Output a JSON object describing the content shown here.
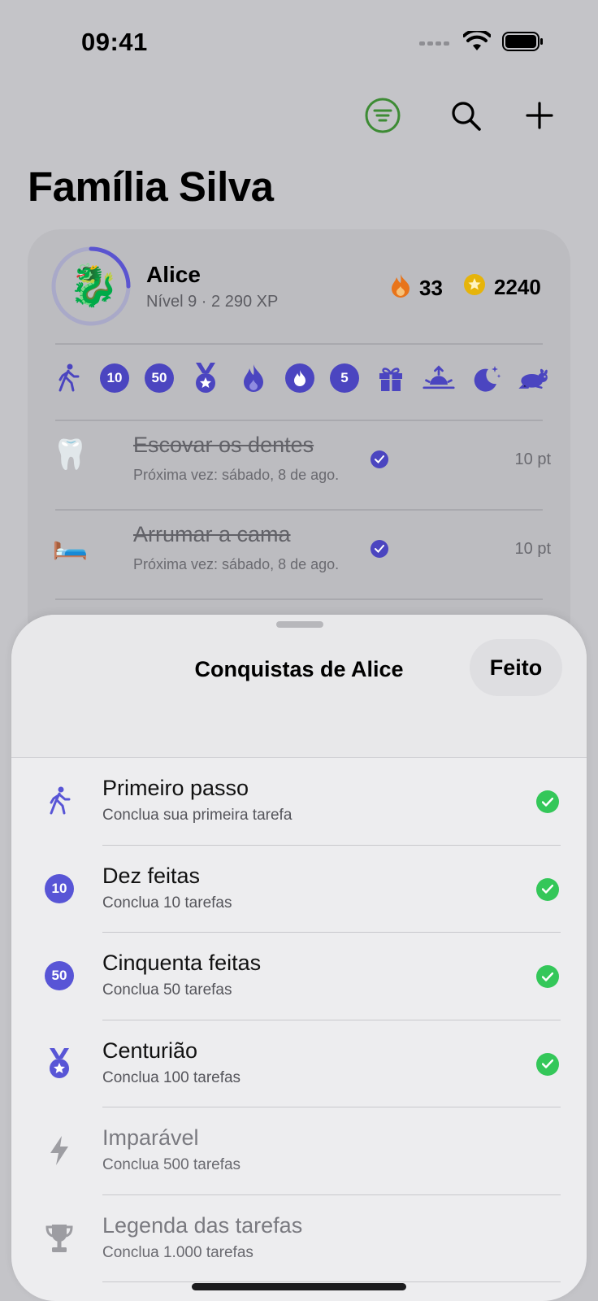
{
  "status_bar": {
    "time": "09:41"
  },
  "toolbar": {
    "icons": [
      "filter-icon",
      "search-icon",
      "plus-icon"
    ],
    "filter_color": "#3d8b34"
  },
  "page": {
    "title": "Família Silva"
  },
  "profile": {
    "name": "Alice",
    "level_text": "Nível 9 · 2 290 XP",
    "avatar_emoji": "🐉",
    "level_progress": 0.25,
    "streak": "33",
    "points": "2240"
  },
  "badges": [
    {
      "icon": "walking-icon"
    },
    {
      "label": "10"
    },
    {
      "label": "50"
    },
    {
      "icon": "medal-icon"
    },
    {
      "icon": "flame-icon"
    },
    {
      "icon": "flame-badge-icon"
    },
    {
      "label": "5"
    },
    {
      "icon": "gift-icon"
    },
    {
      "icon": "sunrise-icon"
    },
    {
      "icon": "moon-stars-icon"
    },
    {
      "icon": "hare-icon"
    }
  ],
  "tasks": [
    {
      "emoji": "🦷",
      "title": "Escovar os dentes",
      "subtitle": "Próxima vez: sábado, 8 de ago.",
      "points": "10 pt"
    },
    {
      "emoji": "🛏️",
      "title": "Arrumar a cama",
      "subtitle": "Próxima vez: sábado, 8 de ago.",
      "points": "10 pt"
    }
  ],
  "sheet": {
    "title": "Conquistas de Alice",
    "done_label": "Feito",
    "achievements": [
      {
        "title": "Primeiro passo",
        "subtitle": "Conclua sua primeira tarefa",
        "icon": "walking-icon",
        "unlocked": true
      },
      {
        "title": "Dez feitas",
        "subtitle": "Conclua 10 tarefas",
        "badge": "10",
        "unlocked": true
      },
      {
        "title": "Cinquenta feitas",
        "subtitle": "Conclua 50 tarefas",
        "badge": "50",
        "unlocked": true
      },
      {
        "title": "Centurião",
        "subtitle": "Conclua 100 tarefas",
        "icon": "medal-icon",
        "unlocked": true
      },
      {
        "title": "Imparável",
        "subtitle": "Conclua 500 tarefas",
        "icon": "bolt-icon",
        "unlocked": false
      },
      {
        "title": "Legenda das tarefas",
        "subtitle": "Conclua 1.000 tarefas",
        "icon": "trophy-icon",
        "unlocked": false
      }
    ]
  },
  "colors": {
    "accent": "#4b45c0",
    "badge": "#5855d6",
    "success": "#34c759",
    "streak": "#e8741a",
    "coin": "#e6b40a"
  }
}
